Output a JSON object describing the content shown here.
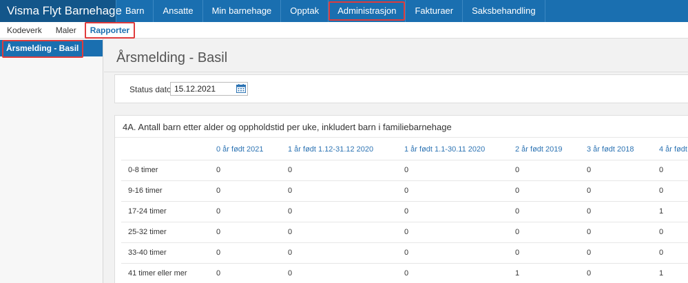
{
  "app": {
    "title": "Visma Flyt Barnehage"
  },
  "nav": {
    "items": [
      "Barn",
      "Ansatte",
      "Min barnehage",
      "Opptak",
      "Administrasjon",
      "Fakturaer",
      "Saksbehandling"
    ],
    "active": "Administrasjon"
  },
  "subnav": {
    "items": [
      "Kodeverk",
      "Maler",
      "Rapporter"
    ],
    "active": "Rapporter"
  },
  "sidebar": {
    "items": [
      "Årsmelding - Basil"
    ]
  },
  "page": {
    "title": "Årsmelding - Basil",
    "status_label": "Status dato",
    "status_date": "15.12.2021"
  },
  "table": {
    "heading": "4A. Antall barn etter alder og oppholdstid per uke, inkludert barn i familiebarnehage",
    "columns": [
      "0 år født 2021",
      "1 år født 1.12-31.12 2020",
      "1 år født 1.1-30.11 2020",
      "2 år født 2019",
      "3 år født 2018",
      "4 år født"
    ],
    "rows": [
      {
        "label": "0-8 timer",
        "values": [
          "0",
          "0",
          "0",
          "0",
          "0",
          "0"
        ]
      },
      {
        "label": "9-16 timer",
        "values": [
          "0",
          "0",
          "0",
          "0",
          "0",
          "0"
        ]
      },
      {
        "label": "17-24 timer",
        "values": [
          "0",
          "0",
          "0",
          "0",
          "0",
          "1"
        ]
      },
      {
        "label": "25-32 timer",
        "values": [
          "0",
          "0",
          "0",
          "0",
          "0",
          "0"
        ]
      },
      {
        "label": "33-40 timer",
        "values": [
          "0",
          "0",
          "0",
          "0",
          "0",
          "0"
        ]
      },
      {
        "label": "41 timer eller mer",
        "values": [
          "0",
          "0",
          "0",
          "1",
          "0",
          "1"
        ]
      }
    ]
  },
  "icons": {
    "calendar": "calendar-icon"
  },
  "colors": {
    "nav_bg": "#1a6fb0",
    "brand_bg": "#13568a",
    "highlight": "#e03b3b",
    "link": "#2c73b3"
  }
}
